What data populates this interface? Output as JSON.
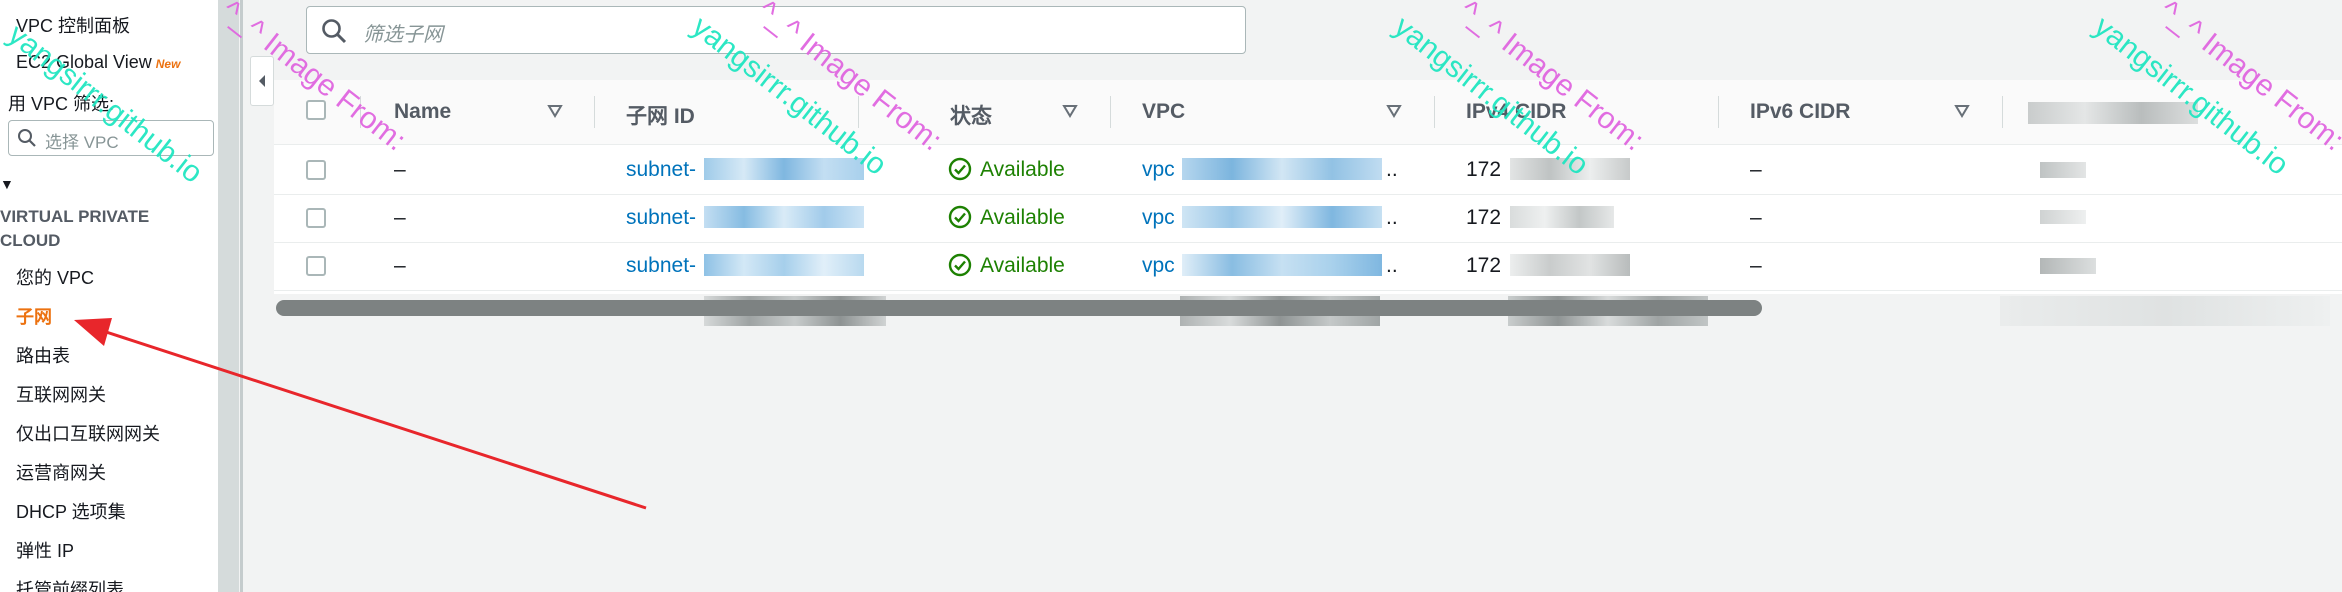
{
  "sidebar": {
    "items_top": [
      "VPC 控制面板",
      "EC2 Global View",
      "用 VPC 筛选:"
    ],
    "new_badge": "New",
    "vpc_filter_placeholder": "选择 VPC",
    "section_title": "VIRTUAL PRIVATE CLOUD",
    "items": [
      "您的 VPC",
      "子网",
      "路由表",
      "互联网网关",
      "仅出口互联网网关",
      "运营商网关",
      "DHCP 选项集",
      "弹性 IP",
      "托管前缀列表"
    ],
    "active_item": "子网"
  },
  "search": {
    "placeholder": "筛选子网"
  },
  "table": {
    "columns": [
      "Name",
      "子网 ID",
      "状态",
      "VPC",
      "IPv4 CIDR",
      "IPv6 CIDR"
    ],
    "rows": [
      {
        "name": "–",
        "subnet_id": "subnet-",
        "status": "Available",
        "vpc": "vpc",
        "ellipsis": "..",
        "ipv4": "172",
        "ipv6": "–"
      },
      {
        "name": "–",
        "subnet_id": "subnet-",
        "status": "Available",
        "vpc": "vpc",
        "ellipsis": "..",
        "ipv4": "172",
        "ipv6": "–"
      },
      {
        "name": "–",
        "subnet_id": "subnet-",
        "status": "Available",
        "vpc": "vpc",
        "ellipsis": "..",
        "ipv4": "172",
        "ipv6": "–"
      }
    ]
  },
  "watermark": {
    "line1": "^_^ Image From:",
    "line2": "yangsirrr.github.io"
  },
  "colors": {
    "accent_orange": "#ec7211",
    "link_blue": "#0073bb",
    "status_green": "#1d8102",
    "arrow_red": "#e8262b",
    "watermark_cyan": "#21e6c1",
    "watermark_magenta": "#e066e0"
  }
}
